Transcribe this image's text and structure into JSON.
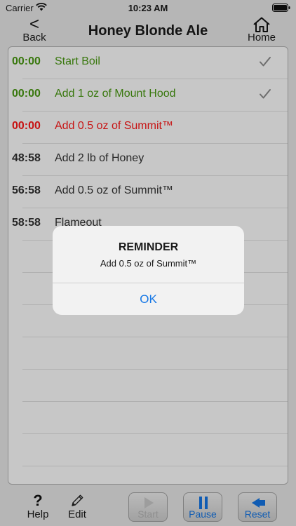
{
  "status_bar": {
    "carrier": "Carrier",
    "time": "10:23 AM"
  },
  "nav": {
    "back_label": "Back",
    "back_chevron": "<",
    "title": "Honey Blonde Ale",
    "home_label": "Home"
  },
  "timeline": [
    {
      "time": "00:00",
      "label": "Start Boil",
      "state": "done",
      "checked": true
    },
    {
      "time": "00:00",
      "label": "Add 1 oz of Mount Hood",
      "state": "done",
      "checked": true
    },
    {
      "time": "00:00",
      "label": "Add 0.5 oz of Summit™",
      "state": "due",
      "checked": false
    },
    {
      "time": "48:58",
      "label": "Add 2 lb of Honey",
      "state": "pending",
      "checked": false
    },
    {
      "time": "56:58",
      "label": "Add 0.5 oz of Summit™",
      "state": "pending",
      "checked": false
    },
    {
      "time": "58:58",
      "label": "Flameout",
      "state": "pending",
      "checked": false
    }
  ],
  "alert": {
    "title": "REMINDER",
    "message": "Add 0.5 oz of Summit™",
    "ok_label": "OK"
  },
  "toolbar": {
    "help_label": "Help",
    "help_glyph": "?",
    "edit_label": "Edit",
    "start_label": "Start",
    "pause_label": "Pause",
    "reset_label": "Reset"
  },
  "colors": {
    "done": "#4a9a12",
    "due": "#ff1a1a",
    "pending": "#333333",
    "accent": "#1577e6"
  }
}
